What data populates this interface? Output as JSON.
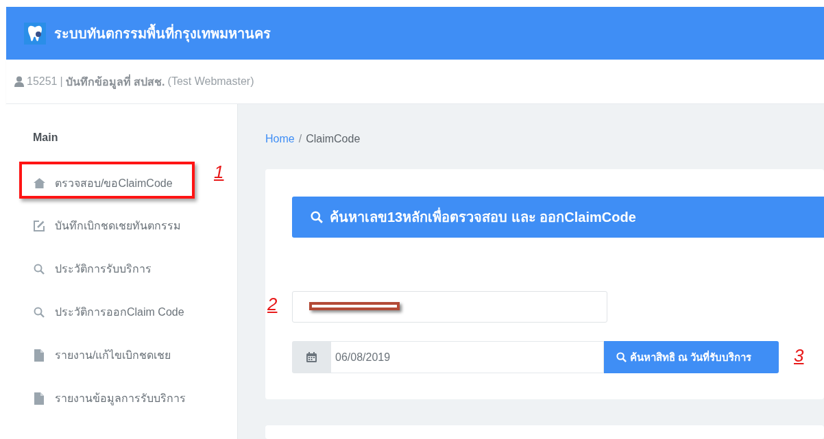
{
  "header": {
    "title": "ระบบทันตกรรมพื้นที่กรุงเทพมหานคร"
  },
  "user_bar": {
    "user_id": "15251",
    "separator": "|",
    "role": "บันทึกข้อมูลที่ สปสช.",
    "name": "(Test Webmaster)"
  },
  "sidebar": {
    "heading": "Main",
    "items": [
      {
        "label": "ตรวจสอบ/ขอClaimCode",
        "kind": "home",
        "highlighted": true,
        "callout": "1"
      },
      {
        "label": "บันทึกเบิกชดเชยทันตกรรม",
        "kind": "edit",
        "highlighted": false
      },
      {
        "label": "ประวัติการรับบริการ",
        "kind": "search",
        "highlighted": false
      },
      {
        "label": "ประวัติการออกClaim Code",
        "kind": "search",
        "highlighted": false
      },
      {
        "label": "รายงาน/แก้ไขเบิกชดเชย",
        "kind": "file",
        "highlighted": false
      },
      {
        "label": "รายงานข้อมูลการรับบริการ",
        "kind": "file",
        "highlighted": false
      }
    ]
  },
  "breadcrumb": [
    {
      "label": "Home",
      "kind": "link"
    },
    {
      "label": "/",
      "kind": "separator"
    },
    {
      "label": "ClaimCode",
      "kind": "current"
    }
  ],
  "card": {
    "title": "ค้นหาเลข13หลักเพื่อตรวจสอบ และ ออกClaimCode",
    "id_field": {
      "redacted": true,
      "callout": "2"
    },
    "date_field": {
      "value": "06/08/2019"
    },
    "search_button": {
      "label": "ค้นหาสิทธิ ณ วันที่รับบริการ",
      "callout": "3"
    }
  }
}
